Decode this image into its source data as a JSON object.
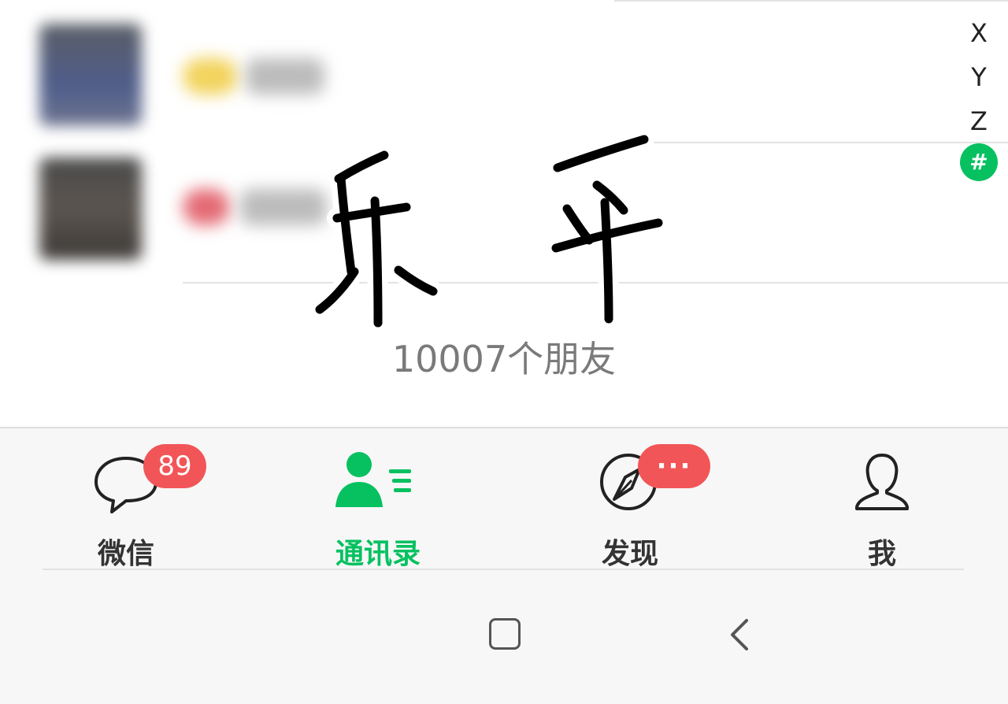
{
  "index_bar": {
    "letters": [
      "X",
      "Y",
      "Z"
    ],
    "active": "#"
  },
  "handwriting": "乐 乎",
  "friend_count": "10007个朋友",
  "tabs": [
    {
      "label": "微信",
      "icon": "chat-bubble-icon",
      "badge": "89",
      "active": false
    },
    {
      "label": "通讯录",
      "icon": "contacts-icon",
      "badge": "",
      "active": true
    },
    {
      "label": "发现",
      "icon": "compass-icon",
      "badge": "···",
      "active": false
    },
    {
      "label": "我",
      "icon": "person-outline-icon",
      "badge": "",
      "active": false
    }
  ],
  "colors": {
    "accent": "#07c160",
    "badge": "#f25557",
    "tab_bar_bg": "#f7f7f7"
  },
  "system_nav": [
    "home-square-icon",
    "back-chevron-icon"
  ]
}
